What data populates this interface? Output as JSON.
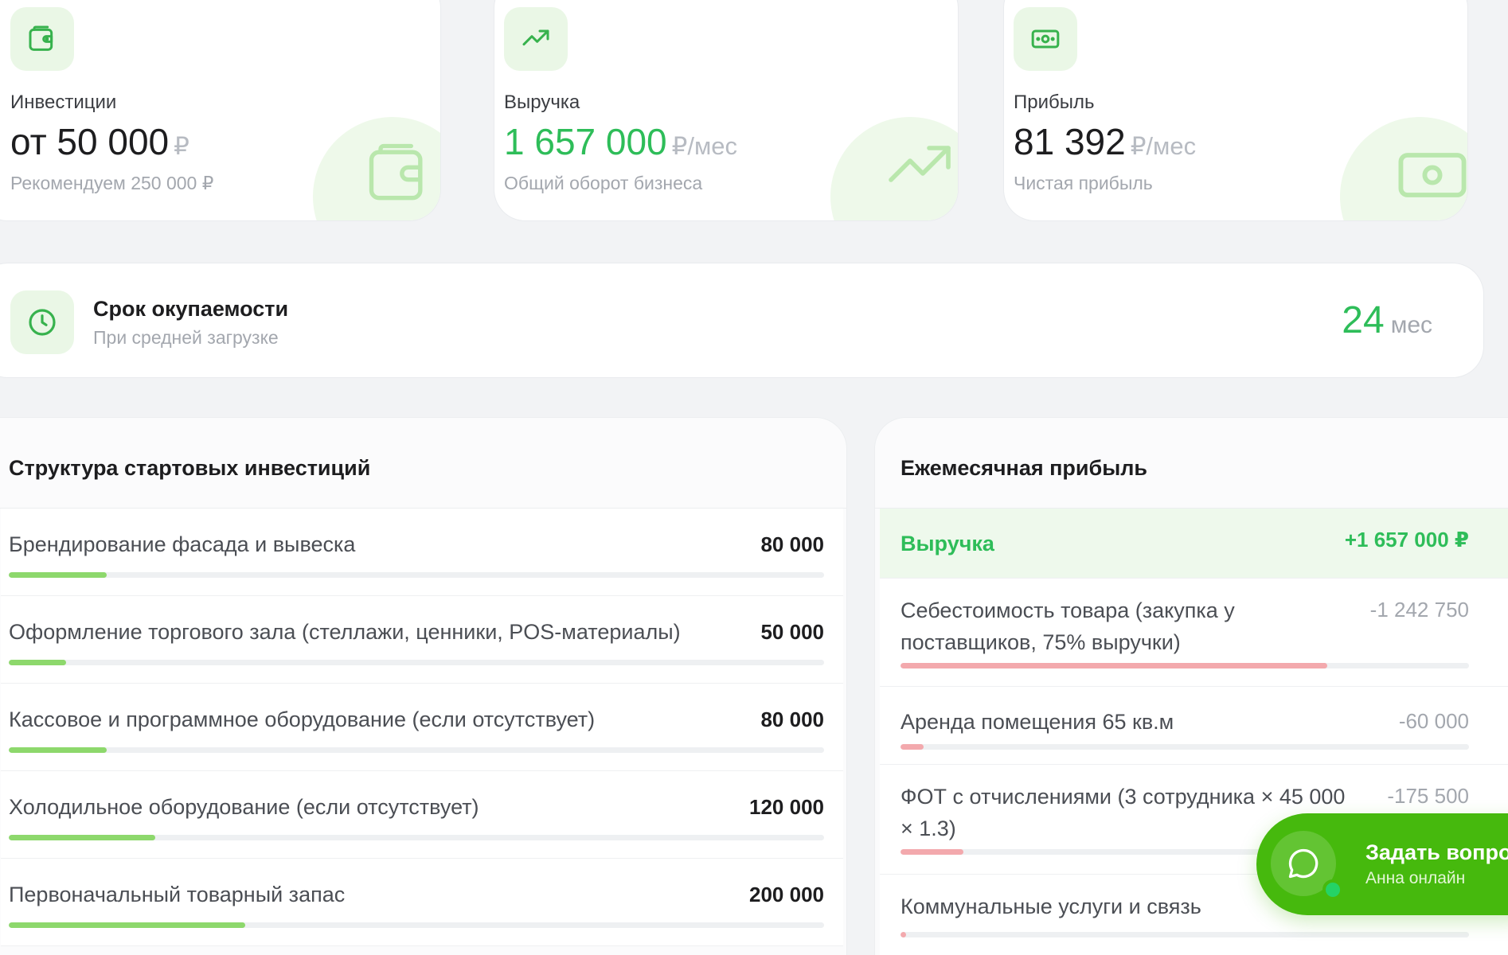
{
  "colors": {
    "accent_green": "#2ebd59",
    "bar_green": "#8dd86c",
    "bar_red": "#f3a9ad",
    "chat_green": "#46b90d",
    "background": "#f2f3f5"
  },
  "stats": {
    "investments": {
      "icon": "wallet-icon",
      "label": "Инвестиции",
      "value": "от 50 000",
      "unit": "₽",
      "sub": "Рекомендуем 250 000 ₽"
    },
    "revenue": {
      "icon": "trending-up-icon",
      "label": "Выручка",
      "value": "1 657 000",
      "unit": "₽/мес",
      "sub": "Общий оборот бизнеса"
    },
    "profit": {
      "icon": "banknote-icon",
      "label": "Прибыль",
      "value": "81 392",
      "unit": "₽/мес",
      "sub": "Чистая прибыль"
    }
  },
  "payback": {
    "icon": "clock-icon",
    "title": "Срок окупаемости",
    "subtitle": "При средней загрузке",
    "value": "24",
    "unit": "мес"
  },
  "investment_structure": {
    "title": "Структура стартовых инвестиций",
    "items": [
      {
        "name": "Брендирование фасада и вывеска",
        "amount": "80 000",
        "share": 0.12
      },
      {
        "name": "Оформление торгового зала (стеллажи, ценники, POS-материалы)",
        "amount": "50 000",
        "share": 0.07
      },
      {
        "name": "Кассовое и программное оборудование (если отсутствует)",
        "amount": "80 000",
        "share": 0.12
      },
      {
        "name": "Холодильное оборудование (если отсутствует)",
        "amount": "120 000",
        "share": 0.18
      },
      {
        "name": "Первоначальный товарный запас",
        "amount": "200 000",
        "share": 0.29
      }
    ]
  },
  "monthly_profit": {
    "title": "Ежемесячная прибыль",
    "revenue_label": "Выручка",
    "revenue_amount": "+1 657 000 ₽",
    "items": [
      {
        "name": "Себестоимость товара (закупка у поставщиков, 75% выручки)",
        "amount": "-1 242 750",
        "share": 0.75
      },
      {
        "name": "Аренда помещения 65 кв.м",
        "amount": "-60 000",
        "share": 0.04
      },
      {
        "name": "ФОТ с отчислениями (3 сотрудника × 45 000 × 1.3)",
        "amount": "-175 500",
        "share": 0.11
      },
      {
        "name": "Коммунальные услуги и связь",
        "amount": "",
        "share": 0.01
      }
    ]
  },
  "chat": {
    "icon": "chat-bubble-icon",
    "title": "Задать вопрос",
    "subtitle": "Анна онлайн"
  }
}
